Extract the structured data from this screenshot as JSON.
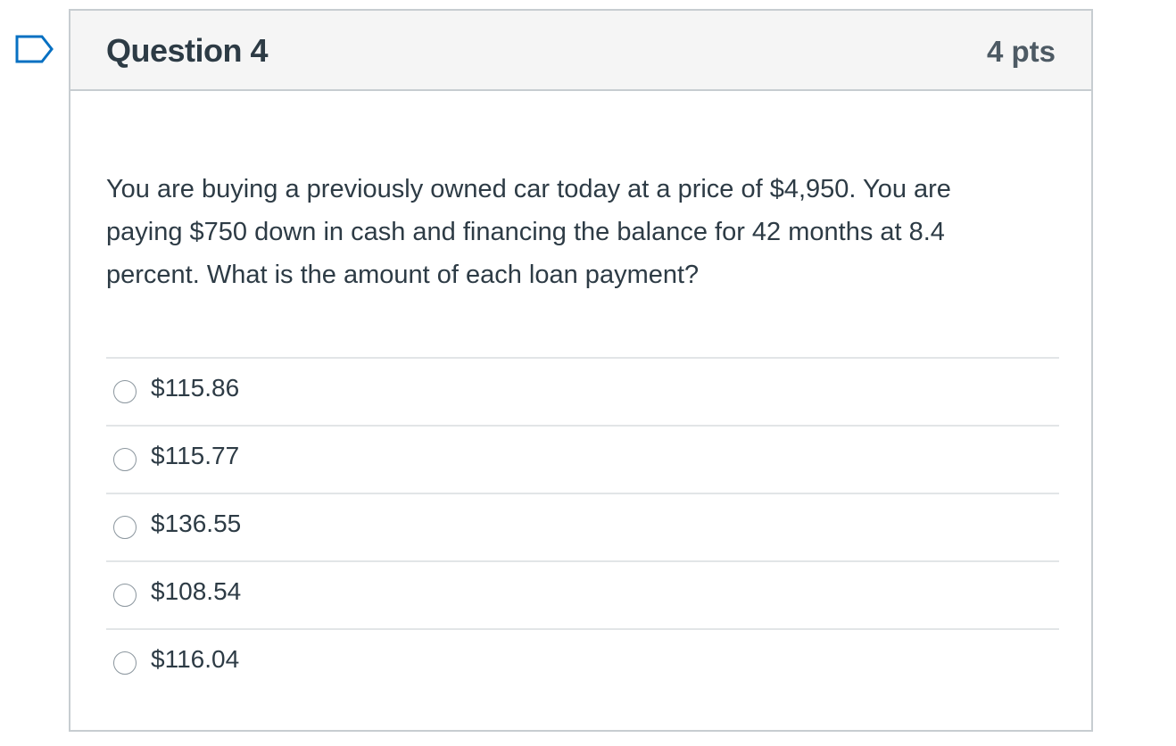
{
  "question": {
    "title": "Question 4",
    "points": "4 pts",
    "text": "You are buying a previously owned car today at a price of $4,950. You are paying $750 down in cash and financing the balance for 42 months at 8.4 percent. What is the amount of each loan payment?",
    "flag_icon": "bookmark-flag-icon",
    "answers": [
      {
        "label": "$115.86",
        "selected": false
      },
      {
        "label": "$115.77",
        "selected": false
      },
      {
        "label": "$136.55",
        "selected": false
      },
      {
        "label": "$108.54",
        "selected": false
      },
      {
        "label": "$116.04",
        "selected": false
      }
    ]
  },
  "colors": {
    "flag": "#0770c2",
    "border": "#c7cdd1",
    "header_bg": "#f5f5f5",
    "text": "#2d3b45"
  }
}
